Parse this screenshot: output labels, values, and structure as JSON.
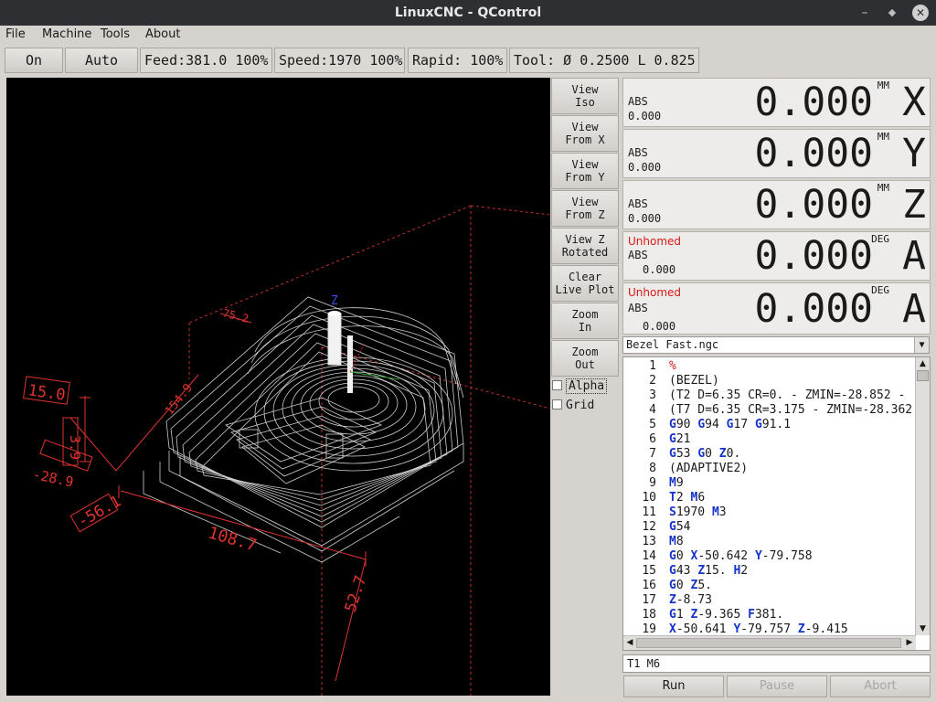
{
  "window": {
    "title": "LinuxCNC - QControl",
    "min": "–",
    "max": "◆",
    "close": "✕"
  },
  "menu": [
    "File",
    "Machine",
    "Tools",
    "About"
  ],
  "toolbar": {
    "on_label": "On",
    "mode_label": "Auto",
    "feed": "Feed:381.0 100%",
    "speed": "Speed:1970 100%",
    "rapid": "Rapid: 100%",
    "tool": "Tool: Ø 0.2500 L 0.825"
  },
  "view_buttons": [
    [
      "View",
      "Iso"
    ],
    [
      "View",
      "From X"
    ],
    [
      "View",
      "From Y"
    ],
    [
      "View",
      "From Z"
    ],
    [
      "View Z",
      "Rotated"
    ],
    [
      "Clear",
      "Live Plot"
    ],
    [
      "Zoom",
      "In"
    ],
    [
      "Zoom",
      "Out"
    ]
  ],
  "checkboxes": {
    "alpha": "Alpha",
    "grid": "Grid"
  },
  "plot_labels": {
    "dim_15": "15.0",
    "dim_39": "3.9",
    "dim_289": "-28.9",
    "dim_561": "-56.1",
    "dim_1087": "108.7",
    "dim_527": "52.7",
    "dim_1549": "154.9",
    "dim_752": "75.2",
    "axis_z": "Z"
  },
  "dro": [
    {
      "status": "",
      "abs_label": "ABS",
      "abs_value": "0.000",
      "value": "0.000",
      "unit": "MM",
      "axis": "X"
    },
    {
      "status": "",
      "abs_label": "ABS",
      "abs_value": "0.000",
      "value": "0.000",
      "unit": "MM",
      "axis": "Y"
    },
    {
      "status": "",
      "abs_label": "ABS",
      "abs_value": "0.000",
      "value": "0.000",
      "unit": "MM",
      "axis": "Z"
    },
    {
      "status": "Unhomed",
      "abs_label": "ABS",
      "abs_value": "0.000",
      "value": "0.000",
      "unit": "DEG",
      "axis": "A"
    },
    {
      "status": "Unhomed",
      "abs_label": "ABS",
      "abs_value": "0.000",
      "value": "0.000",
      "unit": "DEG",
      "axis": "A"
    }
  ],
  "file": {
    "name": "Bezel Fast.ngc"
  },
  "gcode_lines": [
    {
      "n": "1",
      "t": "%"
    },
    {
      "n": "2",
      "t": "(BEZEL)"
    },
    {
      "n": "3",
      "t": "(T2  D=6.35 CR=0. - ZMIN=-28.852 - "
    },
    {
      "n": "4",
      "t": "(T7  D=6.35 CR=3.175 - ZMIN=-28.362"
    },
    {
      "n": "5",
      "t": "G90 G94 G17 G91.1"
    },
    {
      "n": "6",
      "t": "G21"
    },
    {
      "n": "7",
      "t": "G53 G0 Z0."
    },
    {
      "n": "8",
      "t": "(ADAPTIVE2)"
    },
    {
      "n": "9",
      "t": "M9"
    },
    {
      "n": "10",
      "t": "T2 M6"
    },
    {
      "n": "11",
      "t": "S1970 M3"
    },
    {
      "n": "12",
      "t": "G54"
    },
    {
      "n": "13",
      "t": "M8"
    },
    {
      "n": "14",
      "t": "G0 X-50.642 Y-79.758"
    },
    {
      "n": "15",
      "t": "G43 Z15. H2"
    },
    {
      "n": "16",
      "t": "G0 Z5."
    },
    {
      "n": "17",
      "t": "Z-8.73"
    },
    {
      "n": "18",
      "t": "G1 Z-9.365 F381."
    },
    {
      "n": "19",
      "t": "X-50.641 Y-79.757 Z-9.415"
    }
  ],
  "mdi": {
    "value": "T1 M6"
  },
  "run_buttons": {
    "run": "Run",
    "pause": "Pause",
    "abort": "Abort"
  },
  "colors": {
    "keyword": "#1533c9",
    "percent": "#d61818",
    "unhomed": "#d61818",
    "plot_dim": "#e0332f"
  }
}
